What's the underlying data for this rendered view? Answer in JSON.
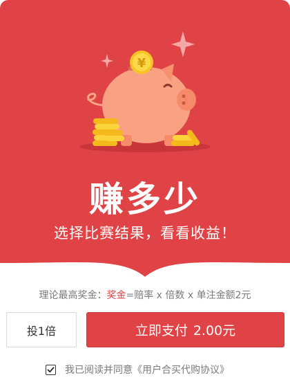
{
  "hero": {
    "headline": "赚多少",
    "subline": "选择比赛结果，看看收益！",
    "coin_symbol": "¥",
    "background_color": "#e04346"
  },
  "formula": {
    "prefix": "理论最高奖金：",
    "highlight": "奖金",
    "suffix": "=赔率 x 倍数 x 单注金额2元",
    "highlight_color": "#e04346"
  },
  "actions": {
    "multiplier_label": "投1倍",
    "pay_label": "立即支付",
    "pay_amount": "2.00元"
  },
  "agreement": {
    "checked": true,
    "prefix": "我已阅读并同意",
    "link": "《用户合买代购协议》"
  }
}
